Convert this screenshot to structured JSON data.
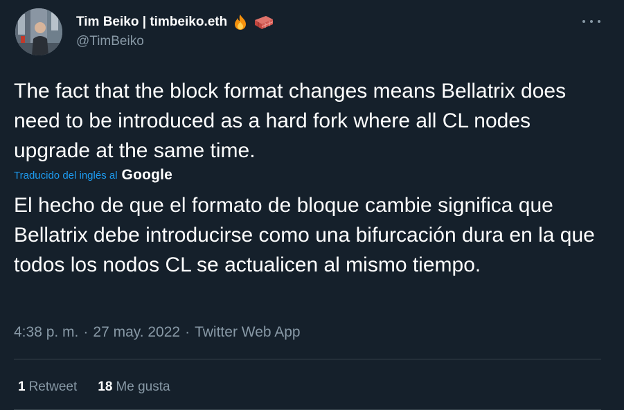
{
  "author": {
    "display_name": "Tim Beiko | timbeiko.eth",
    "handle": "@TimBeiko",
    "emoji_icons": [
      "fire-emoji",
      "brick-emoji"
    ],
    "avatar_icon": "avatar-photo"
  },
  "more_icon": "more-options-icon",
  "tweet": {
    "original_text": "The fact that the block format changes means Bellatrix does need to be introduced as a hard fork where all CL nodes upgrade at the same time.",
    "translated_by_label": "Traducido del inglés al",
    "translator_logo": "Google",
    "translated_text": "El hecho de que el formato de bloque cambie significa que Bellatrix debe introducirse como una bifurcación dura en la que todos los nodos CL se actualicen al mismo tiempo."
  },
  "meta": {
    "time": "4:38 p. m.",
    "separator": "·",
    "date": "27 may. 2022",
    "source": "Twitter Web App"
  },
  "stats": {
    "retweets_count": "1",
    "retweets_label": "Retweet",
    "likes_count": "18",
    "likes_label": "Me gusta"
  },
  "colors": {
    "background": "#15202b",
    "text_primary": "#ffffff",
    "text_secondary": "#8899a6",
    "link": "#1d9bf0",
    "divider": "#38444d"
  }
}
